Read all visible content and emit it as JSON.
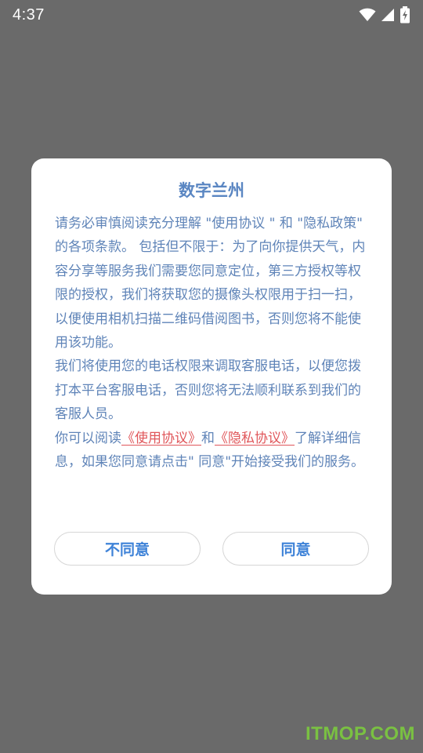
{
  "status_bar": {
    "time": "4:37",
    "icons": [
      "wifi-icon",
      "signal-icon",
      "battery-charging-icon"
    ]
  },
  "dialog": {
    "title": "数字兰州",
    "body_paragraphs": [
      "请务必审慎阅读充分理解 \"使用协议 \" 和 \"隐私政策\" 的各项条款。 包括但不限于：为了向你提供天气，内容分享等服务我们需要您同意定位，第三方授权等权限的授权，我们将获取您的摄像头权限用于扫一扫，以便使用相机扫描二维码借阅图书，否则您将不能使用该功能。",
      "我们将使用您的电话权限来调取客服电话，以便您拨打本平台客服电话，否则您将无法顺利联系到我们的客服人员。"
    ],
    "final_paragraph": {
      "prefix": "你可以阅读",
      "link_usage": "《使用协议》",
      "middle": "和",
      "link_privacy": "《隐私协议》",
      "suffix": "了解详细信息，如果您同意请点击\" 同意\"开始接受我们的服务。"
    },
    "buttons": {
      "disagree": "不同意",
      "agree": "同意"
    }
  },
  "watermark": "ITMOP.COM",
  "colors": {
    "overlay": "#6a6a6a",
    "title": "#5a86c2",
    "body_text": "#5f84b8",
    "link": "#e0565a",
    "button_text": "#3f83d8"
  }
}
